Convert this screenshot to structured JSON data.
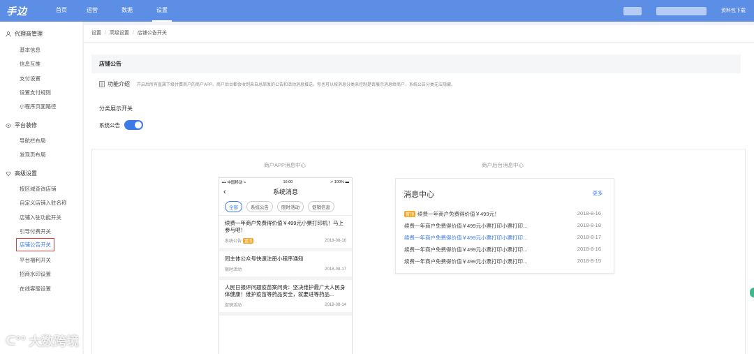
{
  "topbar": {
    "logo": "手边",
    "nav": [
      {
        "label": "首页"
      },
      {
        "label": "运营"
      },
      {
        "label": "数据"
      },
      {
        "label": "设置"
      }
    ],
    "download": "资料包下载"
  },
  "sidebar": {
    "groups": [
      {
        "title": "代理商管理",
        "items": [
          "基本信息",
          "信息互推",
          "支付设置",
          "设置支付规则",
          "小程序页面路径"
        ]
      },
      {
        "title": "平台装修",
        "items": [
          "导航栏布局",
          "发现页布局"
        ]
      },
      {
        "title": "高级设置",
        "items": [
          "按区域查询店铺",
          "自定义店铺入驻名称",
          "店铺入驻功能开关",
          "引导付费开关",
          "店铺公告开关",
          "平台福利开关",
          "招商水印设置",
          "在线客服设置"
        ]
      }
    ]
  },
  "breadcrumb": [
    "设置",
    "高级设置",
    "店铺公告开关"
  ],
  "panel": {
    "title": "店铺公告",
    "intro_label": "功能介绍",
    "intro_desc": "开启后所有直属下级付费商户的商户APP、商户后台都会收到来自总部发的公告和活动消息推送。你也可以按消息分类来控制是否展示消息给商户，系统公告分类无法隐藏。",
    "category_title": "分类展示开关",
    "toggle_label": "系统公告",
    "toggle_on": true
  },
  "preview": {
    "app_label": "商户APP消息中心",
    "admin_label": "商户后台消息中心",
    "phone": {
      "carrier": "中国移动",
      "time": "16:00",
      "battery": "100%",
      "title": "系统消息",
      "chips": [
        "全部",
        "系统公告",
        "限时活动",
        "促销信息"
      ],
      "messages": [
        {
          "title": "续费一年商户免费得价值￥499元小票打印机！马上参与吧！",
          "tag": "系统公告",
          "badge": "置顶",
          "date": "2018-08-16"
        },
        {
          "title": "同主体公众号快速注册小程序通知",
          "tag": "限时活动",
          "badge": "",
          "date": "2018-08-17"
        },
        {
          "title": "人民日报评问题疫苗案问责：坚决维护最广大人民身体健康！维护疫苗等药品安全，就要进等药品...",
          "tag": "促销活动",
          "badge": "",
          "date": "2018-08-14"
        }
      ]
    },
    "admin": {
      "title": "消息中心",
      "more": "更多",
      "rows": [
        {
          "badge": "置顶",
          "text": "续费一年商户免费得价值￥499元！",
          "date": "2018-8-16"
        },
        {
          "badge": "",
          "text": "续费一年商户免费得价值￥499元小票打印小票打印...",
          "date": "2018-8-18"
        },
        {
          "badge": "",
          "text": "续费一年商户免费得价值￥499元小票打印小票打印...",
          "date": "2018-8-17"
        },
        {
          "badge": "",
          "text": "续费一年商户免费得价值￥499元小票打印小票打印...",
          "date": "2018-8-16"
        },
        {
          "badge": "",
          "text": "续费一年商户免费得价值￥499元小票打印小票打印...",
          "date": "2018-8-15"
        }
      ]
    }
  },
  "watermark": "大数跨境",
  "colors": {
    "primary": "#3a7be8",
    "topbar": "#5c8ee6",
    "highlight_border": "#e53935",
    "badge": "#f5a623"
  }
}
